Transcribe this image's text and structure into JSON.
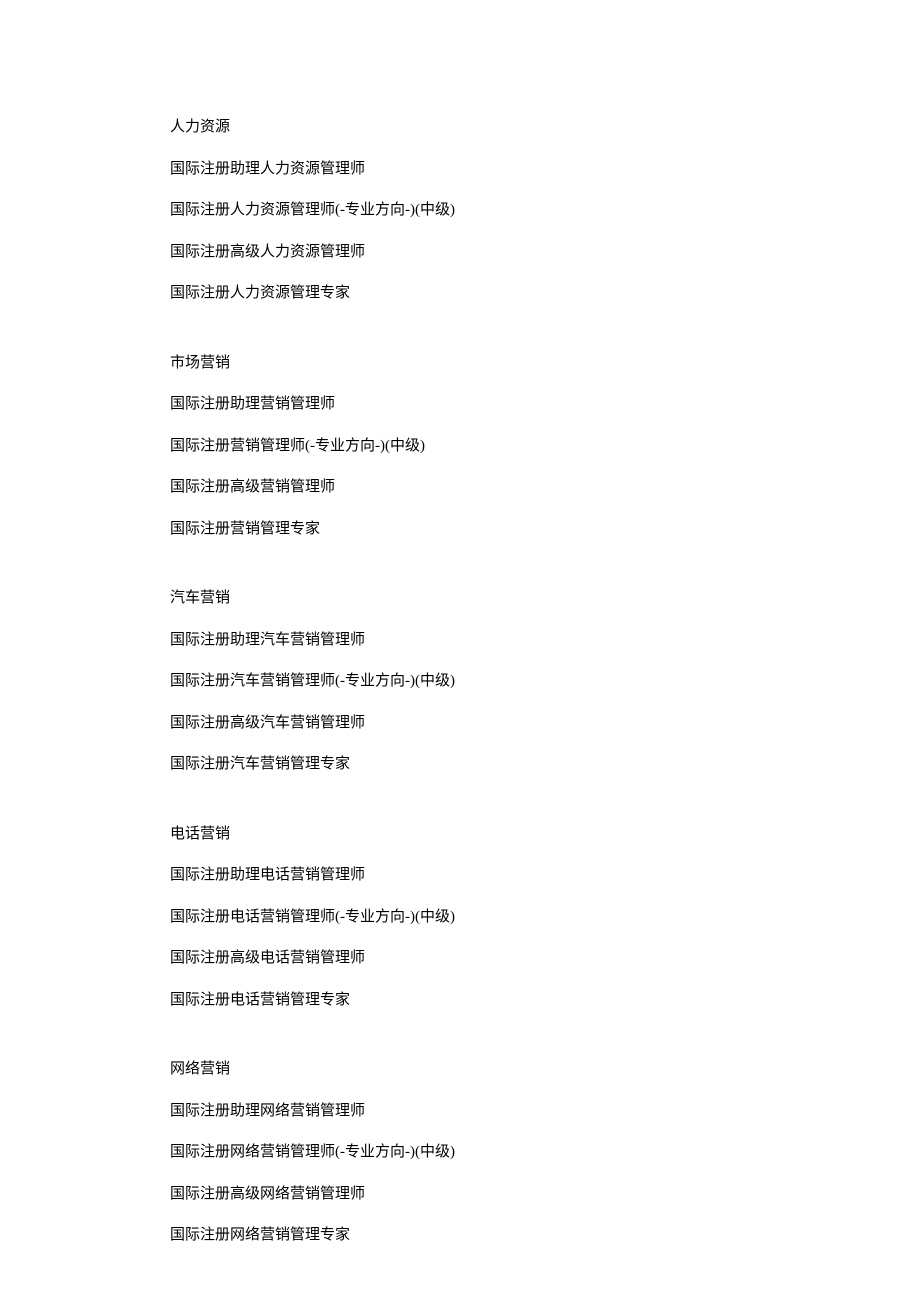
{
  "sections": [
    {
      "heading": "人力资源",
      "items": [
        "国际注册助理人力资源管理师",
        "国际注册人力资源管理师(-专业方向-)(中级)",
        "国际注册高级人力资源管理师",
        "国际注册人力资源管理专家"
      ]
    },
    {
      "heading": "市场营销",
      "items": [
        "国际注册助理营销管理师",
        "国际注册营销管理师(-专业方向-)(中级)",
        "国际注册高级营销管理师",
        "国际注册营销管理专家"
      ]
    },
    {
      "heading": "汽车营销",
      "items": [
        "国际注册助理汽车营销管理师",
        "国际注册汽车营销管理师(-专业方向-)(中级)",
        "国际注册高级汽车营销管理师",
        "国际注册汽车营销管理专家"
      ]
    },
    {
      "heading": "电话营销",
      "items": [
        "国际注册助理电话营销管理师",
        "国际注册电话营销管理师(-专业方向-)(中级)",
        "国际注册高级电话营销管理师",
        "国际注册电话营销管理专家"
      ]
    },
    {
      "heading": "网络营销",
      "items": [
        "国际注册助理网络营销管理师",
        "国际注册网络营销管理师(-专业方向-)(中级)",
        "国际注册高级网络营销管理师",
        "国际注册网络营销管理专家"
      ]
    }
  ]
}
